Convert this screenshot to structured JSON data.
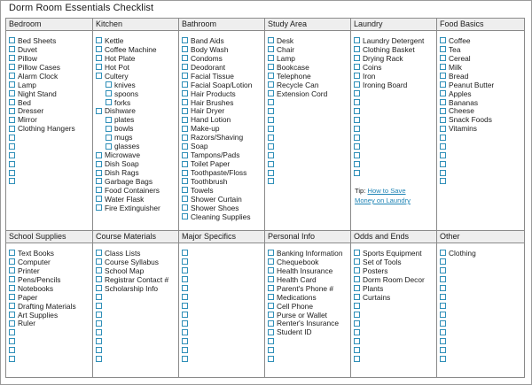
{
  "title": "Dorm Room Essentials Checklist",
  "top_row": [
    {
      "header": "Bedroom",
      "items": [
        {
          "label": "Bed Sheets"
        },
        {
          "label": "Duvet"
        },
        {
          "label": "Pillow"
        },
        {
          "label": "Pillow Cases"
        },
        {
          "label": "Alarm Clock"
        },
        {
          "label": "Lamp"
        },
        {
          "label": "Night Stand"
        },
        {
          "label": "Bed"
        },
        {
          "label": "Dresser"
        },
        {
          "label": "Mirror"
        },
        {
          "label": "Clothing Hangers"
        },
        {
          "label": ""
        },
        {
          "label": ""
        },
        {
          "label": ""
        },
        {
          "label": ""
        },
        {
          "label": ""
        },
        {
          "label": ""
        }
      ]
    },
    {
      "header": "Kitchen",
      "items": [
        {
          "label": "Kettle"
        },
        {
          "label": "Coffee Machine"
        },
        {
          "label": "Hot Plate"
        },
        {
          "label": "Hot Pot"
        },
        {
          "label": "Cultery"
        },
        {
          "label": "knives",
          "indent": true
        },
        {
          "label": "spoons",
          "indent": true
        },
        {
          "label": "forks",
          "indent": true
        },
        {
          "label": "Dishware"
        },
        {
          "label": "plates",
          "indent": true
        },
        {
          "label": "bowls",
          "indent": true
        },
        {
          "label": "mugs",
          "indent": true
        },
        {
          "label": "glasses",
          "indent": true
        },
        {
          "label": "Microwave"
        },
        {
          "label": "Dish Soap"
        },
        {
          "label": "Dish Rags"
        },
        {
          "label": "Garbage Bags"
        },
        {
          "label": "Food Containers"
        },
        {
          "label": "Water Flask"
        },
        {
          "label": "Fire Extinguisher"
        }
      ]
    },
    {
      "header": "Bathroom",
      "items": [
        {
          "label": "Band Aids"
        },
        {
          "label": "Body Wash"
        },
        {
          "label": "Condoms"
        },
        {
          "label": "Deodorant"
        },
        {
          "label": "Facial Tissue"
        },
        {
          "label": "Facial Soap/Lotion"
        },
        {
          "label": "Hair Products"
        },
        {
          "label": "Hair Brushes"
        },
        {
          "label": "Hair Dryer"
        },
        {
          "label": "Hand Lotion"
        },
        {
          "label": "Make-up"
        },
        {
          "label": "Razors/Shaving"
        },
        {
          "label": "Soap"
        },
        {
          "label": "Tampons/Pads"
        },
        {
          "label": "Toilet Paper"
        },
        {
          "label": "Toothpaste/Floss"
        },
        {
          "label": "Toothbrush"
        },
        {
          "label": "Towels"
        },
        {
          "label": "Shower Curtain"
        },
        {
          "label": "Shower Shoes"
        },
        {
          "label": "Cleaning Supplies"
        }
      ]
    },
    {
      "header": "Study Area",
      "items": [
        {
          "label": "Desk"
        },
        {
          "label": "Chair"
        },
        {
          "label": "Lamp"
        },
        {
          "label": "Bookcase"
        },
        {
          "label": "Telephone"
        },
        {
          "label": "Recycle Can"
        },
        {
          "label": "Extension Cord"
        },
        {
          "label": ""
        },
        {
          "label": ""
        },
        {
          "label": ""
        },
        {
          "label": ""
        },
        {
          "label": ""
        },
        {
          "label": ""
        },
        {
          "label": ""
        },
        {
          "label": ""
        },
        {
          "label": ""
        },
        {
          "label": ""
        }
      ]
    },
    {
      "header": "Laundry",
      "items": [
        {
          "label": "Laundry Detergent"
        },
        {
          "label": "Clothing Basket"
        },
        {
          "label": "Drying Rack"
        },
        {
          "label": "Coins"
        },
        {
          "label": "Iron"
        },
        {
          "label": "Ironing Board"
        },
        {
          "label": ""
        },
        {
          "label": ""
        },
        {
          "label": ""
        },
        {
          "label": ""
        },
        {
          "label": ""
        },
        {
          "label": ""
        },
        {
          "label": ""
        },
        {
          "label": ""
        },
        {
          "label": ""
        },
        {
          "label": ""
        }
      ],
      "tip": {
        "prefix": "Tip: ",
        "link_line1": "How to Save",
        "link_line2": "Money on Laundry"
      }
    },
    {
      "header": "Food Basics",
      "items": [
        {
          "label": "Coffee"
        },
        {
          "label": "Tea"
        },
        {
          "label": "Cereal"
        },
        {
          "label": "Milk"
        },
        {
          "label": "Bread"
        },
        {
          "label": "Peanut Butter"
        },
        {
          "label": "Apples"
        },
        {
          "label": "Bananas"
        },
        {
          "label": "Cheese"
        },
        {
          "label": "Snack Foods"
        },
        {
          "label": "Vitamins"
        },
        {
          "label": ""
        },
        {
          "label": ""
        },
        {
          "label": ""
        },
        {
          "label": ""
        },
        {
          "label": ""
        },
        {
          "label": ""
        }
      ]
    }
  ],
  "bottom_row": [
    {
      "header": "School Supplies",
      "items": [
        {
          "label": "Text Books"
        },
        {
          "label": "Computer"
        },
        {
          "label": "Printer"
        },
        {
          "label": "Pens/Pencils"
        },
        {
          "label": "Notebooks"
        },
        {
          "label": "Paper"
        },
        {
          "label": "Drafting Materials"
        },
        {
          "label": "Art Supplies"
        },
        {
          "label": "Ruler"
        },
        {
          "label": ""
        },
        {
          "label": ""
        },
        {
          "label": ""
        },
        {
          "label": ""
        }
      ]
    },
    {
      "header": "Course Materials",
      "items": [
        {
          "label": "Class Lists"
        },
        {
          "label": "Course Syllabus"
        },
        {
          "label": "School Map"
        },
        {
          "label": "Registrar Contact #"
        },
        {
          "label": "Scholarship Info"
        },
        {
          "label": ""
        },
        {
          "label": ""
        },
        {
          "label": ""
        },
        {
          "label": ""
        },
        {
          "label": ""
        },
        {
          "label": ""
        },
        {
          "label": ""
        },
        {
          "label": ""
        }
      ]
    },
    {
      "header": "Major Specifics",
      "items": [
        {
          "label": ""
        },
        {
          "label": ""
        },
        {
          "label": ""
        },
        {
          "label": ""
        },
        {
          "label": ""
        },
        {
          "label": ""
        },
        {
          "label": ""
        },
        {
          "label": ""
        },
        {
          "label": ""
        },
        {
          "label": ""
        },
        {
          "label": ""
        },
        {
          "label": ""
        },
        {
          "label": ""
        }
      ]
    },
    {
      "header": "Personal Info",
      "items": [
        {
          "label": "Banking Information"
        },
        {
          "label": "Chequebook"
        },
        {
          "label": "Health Insurance"
        },
        {
          "label": "Health Card"
        },
        {
          "label": "Parent's Phone #"
        },
        {
          "label": "Medications"
        },
        {
          "label": "Cell Phone"
        },
        {
          "label": "Purse or Wallet"
        },
        {
          "label": "Renter's Insurance"
        },
        {
          "label": "Student ID"
        },
        {
          "label": ""
        },
        {
          "label": ""
        },
        {
          "label": ""
        }
      ]
    },
    {
      "header": "Odds and Ends",
      "items": [
        {
          "label": "Sports Equipment"
        },
        {
          "label": "Set of Tools"
        },
        {
          "label": "Posters"
        },
        {
          "label": "Dorm Room Decor"
        },
        {
          "label": "Plants"
        },
        {
          "label": "Curtains"
        },
        {
          "label": ""
        },
        {
          "label": ""
        },
        {
          "label": ""
        },
        {
          "label": ""
        },
        {
          "label": ""
        },
        {
          "label": ""
        },
        {
          "label": ""
        }
      ]
    },
    {
      "header": "Other",
      "items": [
        {
          "label": "Clothing"
        },
        {
          "label": ""
        },
        {
          "label": ""
        },
        {
          "label": ""
        },
        {
          "label": ""
        },
        {
          "label": ""
        },
        {
          "label": ""
        },
        {
          "label": ""
        },
        {
          "label": ""
        },
        {
          "label": ""
        },
        {
          "label": ""
        },
        {
          "label": ""
        },
        {
          "label": ""
        }
      ]
    }
  ],
  "colors": {
    "checkbox_border": "#2f8fb8",
    "header_bg": "#eeeeee",
    "link": "#1f84b5",
    "grid_line": "#8a8a8a"
  },
  "icons": {
    "checkbox": "checkbox-icon"
  }
}
